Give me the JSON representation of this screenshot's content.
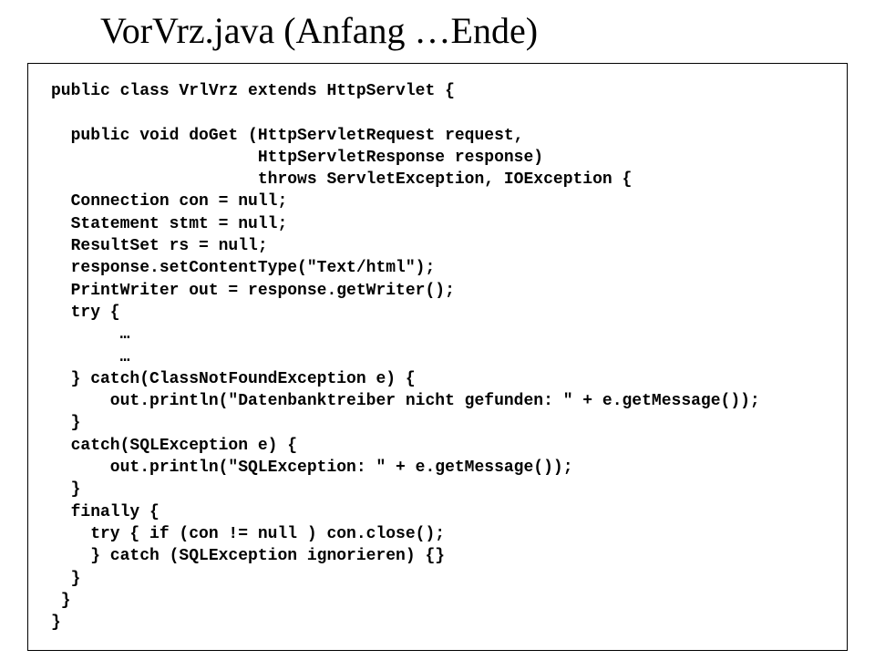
{
  "title": "VorVrz.java (Anfang …Ende)",
  "code": {
    "l1": "public class VrlVrz extends HttpServlet {",
    "l2": "",
    "l3": "  public void doGet (HttpServletRequest request,",
    "l4": "                     HttpServletResponse response)",
    "l5": "                     throws ServletException, IOException {",
    "l6": "  Connection con = null;",
    "l7": "  Statement stmt = null;",
    "l8": "  ResultSet rs = null;",
    "l9": "  response.setContentType(\"Text/html\");",
    "l10": "  PrintWriter out = response.getWriter();",
    "l11": "  try {",
    "l12": "       …",
    "l13": "       …",
    "l14": "  } catch(ClassNotFoundException e) {",
    "l15": "      out.println(\"Datenbanktreiber nicht gefunden: \" + e.getMessage());",
    "l16": "  }",
    "l17": "  catch(SQLException e) {",
    "l18": "      out.println(\"SQLException: \" + e.getMessage());",
    "l19": "  }",
    "l20": "  finally {",
    "l21": "    try { if (con != null ) con.close();",
    "l22": "    } catch (SQLException ignorieren) {}",
    "l23": "  }",
    "l24": " }",
    "l25": "}"
  }
}
